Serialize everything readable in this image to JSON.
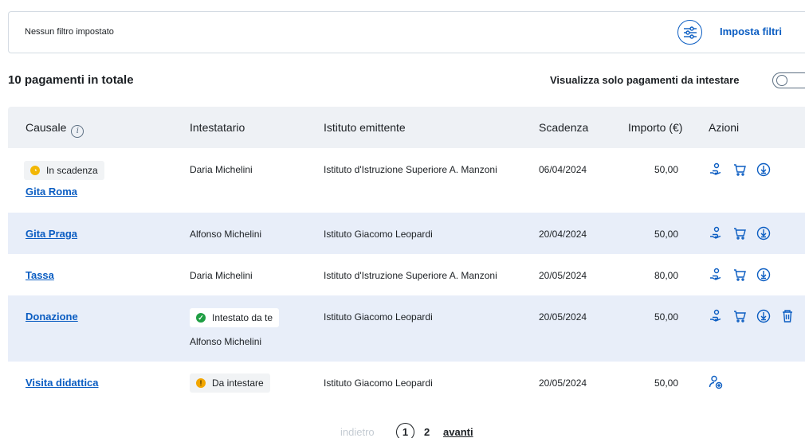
{
  "filters": {
    "status_text": "Nessun filtro impostato",
    "action_label": "Imposta filtri"
  },
  "summary": {
    "total_label": "10 pagamenti in totale",
    "toggle_label": "Visualizza solo pagamenti da intestare",
    "toggle_on": false
  },
  "table": {
    "headers": {
      "causale": "Causale",
      "intestatario": "Intestatario",
      "istituto": "Istituto emittente",
      "scadenza": "Scadenza",
      "importo": "Importo (€)",
      "azioni": "Azioni"
    },
    "rows": [
      {
        "badge": "In scadenza",
        "badge_type": "warning",
        "causale": "Gita Roma",
        "intestatario": "Daria Michelini",
        "istituto": "Istituto d'Istruzione Superiore A. Manzoni",
        "scadenza": "06/04/2024",
        "importo": "50,00",
        "actions": [
          "assign-icon",
          "cart-icon",
          "download-icon"
        ]
      },
      {
        "causale": "Gita Praga",
        "intestatario": "Alfonso Michelini",
        "istituto": "Istituto Giacomo Leopardi",
        "scadenza": "20/04/2024",
        "importo": "50,00",
        "actions": [
          "assign-icon",
          "cart-icon",
          "download-icon"
        ]
      },
      {
        "causale": "Tassa",
        "intestatario": "Daria Michelini",
        "istituto": "Istituto d'Istruzione Superiore A. Manzoni",
        "scadenza": "20/05/2024",
        "importo": "80,00",
        "actions": [
          "assign-icon",
          "cart-icon",
          "download-icon"
        ]
      },
      {
        "causale": "Donazione",
        "badge": "Intestato da te",
        "badge_type": "success",
        "intestatario": "Alfonso Michelini",
        "istituto": "Istituto Giacomo Leopardi",
        "scadenza": "20/05/2024",
        "importo": "50,00",
        "actions": [
          "assign-icon",
          "cart-icon",
          "download-icon",
          "delete-icon"
        ]
      },
      {
        "causale": "Visita didattica",
        "badge": "Da intestare",
        "badge_type": "attention",
        "istituto": "Istituto Giacomo Leopardi",
        "scadenza": "20/05/2024",
        "importo": "50,00",
        "actions": [
          "add-user-icon"
        ]
      }
    ]
  },
  "pagination": {
    "prev": "indietro",
    "current": "1",
    "page2": "2",
    "next": "avanti"
  },
  "colors": {
    "accent": "#0b5dc2",
    "row_highlight": "#e8eef9",
    "header_bg": "#eef1f5"
  }
}
